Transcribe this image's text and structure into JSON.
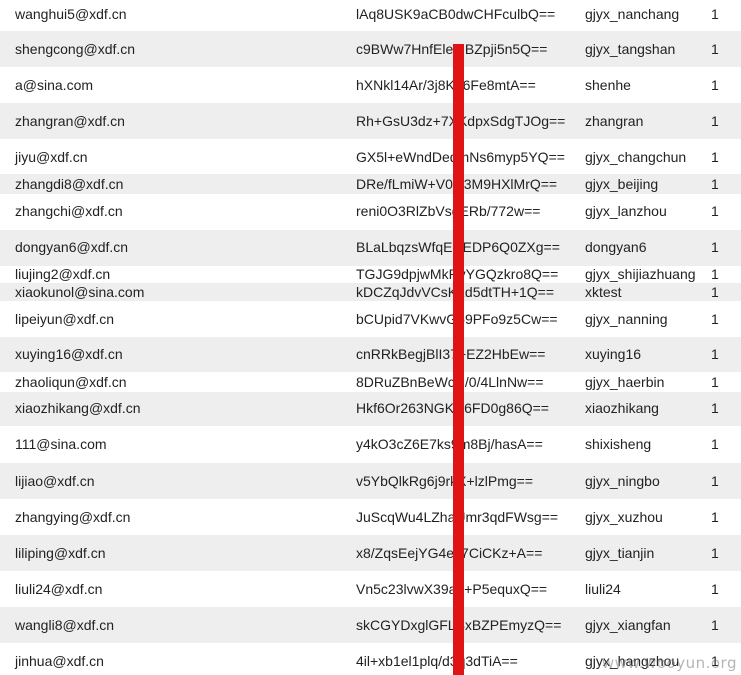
{
  "rows": [
    {
      "email": "wanghui5@xdf.cn",
      "hash": "lAq8USK9aCB0dwCHFculbQ==",
      "user": "gjyx_nanchang",
      "flag": "1"
    },
    {
      "email": "shengcong@xdf.cn",
      "hash": "c9BWw7HnfEleMBZpji5n5Q==",
      "user": "gjyx_tangshan",
      "flag": "1"
    },
    {
      "email": "a@sina.com",
      "hash": "hXNkl14Ar/3j8Kb6Fe8mtA==",
      "user": "shenhe",
      "flag": "1"
    },
    {
      "email": "zhangran@xdf.cn",
      "hash": "Rh+GsU3dz+7XKdpxSdgTJOg==",
      "user": "zhangran",
      "flag": "1"
    },
    {
      "email": "jiyu@xdf.cn",
      "hash": "GX5l+eWndDeqmNs6myp5YQ==",
      "user": "gjyx_changchun",
      "flag": "1"
    },
    {
      "email": "zhangdi8@xdf.cn",
      "hash": "DRe/fLmiW+V0Q3M9HXlMrQ==",
      "user": "gjyx_beijing",
      "flag": "1"
    },
    {
      "email": "zhangchi@xdf.cn",
      "hash": "reni0O3RlZbVsgERb/772w==",
      "user": "gjyx_lanzhou",
      "flag": "1"
    },
    {
      "email": "dongyan6@xdf.cn",
      "hash": "BLaLbqzsWfqECEDP6Q0ZXg==",
      "user": "dongyan6",
      "flag": "1"
    },
    {
      "email": "liujing2@xdf.cn",
      "hash": "TGJG9dpjwMkRyYGQzkro8Q==",
      "user": "gjyx_shijiazhuang",
      "flag": "1"
    },
    {
      "email": "xiaokunol@sina.com",
      "hash": "kDCZqJdvVCsK2d5dtTH+1Q==",
      "user": "xktest",
      "flag": "1"
    },
    {
      "email": "lipeiyun@xdf.cn",
      "hash": "bCUpid7VKwvG59PFo9z5Cw==",
      "user": "gjyx_nanning",
      "flag": "1"
    },
    {
      "email": "xuying16@xdf.cn",
      "hash": "cnRRkBegjBlI37+EZ2HbEw==",
      "user": "xuying16",
      "flag": "1"
    },
    {
      "email": "zhaoliqun@xdf.cn",
      "hash": "8DRuZBnBeWcN/0/4LlnNw==",
      "user": "gjyx_haerbin",
      "flag": "1"
    },
    {
      "email": "xiaozhikang@xdf.cn",
      "hash": "Hkf6Or263NGKN6FD0g86Q==",
      "user": "xiaozhikang",
      "flag": "1"
    },
    {
      "email": "111@sina.com",
      "hash": "y4kO3cZ6E7ks9m8Bj/hasA==",
      "user": "shixisheng",
      "flag": "1"
    },
    {
      "email": "lijiao@xdf.cn",
      "hash": "v5YbQlkRg6j9rkX+lzlPmg==",
      "user": "gjyx_ningbo",
      "flag": "1"
    },
    {
      "email": "zhangying@xdf.cn",
      "hash": "JuScqWu4LZhaUmr3qdFWsg==",
      "user": "gjyx_xuzhou",
      "flag": "1"
    },
    {
      "email": "liliping@xdf.cn",
      "hash": "x8/ZqsEejYG4ey7CiCKz+A==",
      "user": "gjyx_tianjin",
      "flag": "1"
    },
    {
      "email": "liuli24@xdf.cn",
      "hash": "Vn5c23lvwX39a5+P5equxQ==",
      "user": "liuli24",
      "flag": "1"
    },
    {
      "email": "wangli8@xdf.cn",
      "hash": "skCGYDxglGFLSxBZPEmyzQ==",
      "user": "gjyx_xiangfan",
      "flag": "1"
    },
    {
      "email": "jinhua@xdf.cn",
      "hash": "4il+xb1el1plq/d3q3dTiA==",
      "user": "gjyx_hangzhou",
      "flag": "1"
    }
  ],
  "watermark": "www.wooyun.org"
}
